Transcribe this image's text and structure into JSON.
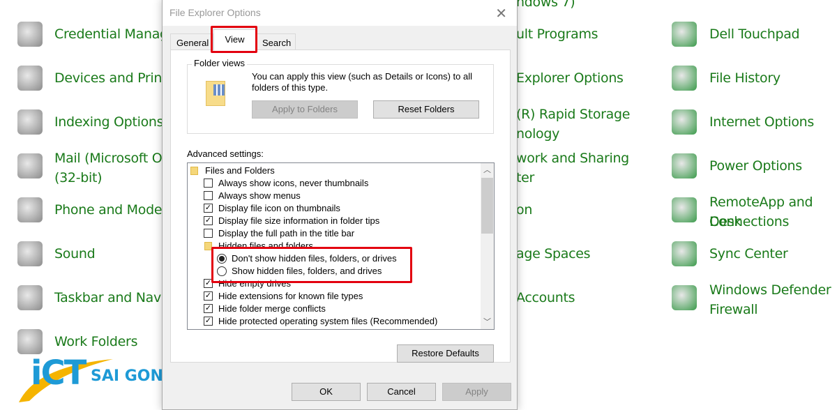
{
  "control_panel": {
    "left": [
      {
        "label": "Credential Manag",
        "icon": "credential-manager-icon"
      },
      {
        "label": "Devices and Printe",
        "icon": "devices-printers-icon"
      },
      {
        "label": "Indexing Options",
        "icon": "indexing-options-icon"
      },
      {
        "label": "Mail (Microsoft O",
        "label2": "(32-bit)",
        "icon": "mail-icon"
      },
      {
        "label": "Phone and Moder",
        "icon": "phone-modem-icon"
      },
      {
        "label": "Sound",
        "icon": "sound-icon"
      },
      {
        "label": "Taskbar and Navig",
        "icon": "taskbar-icon"
      },
      {
        "label": "Work Folders",
        "icon": "work-folders-icon"
      }
    ],
    "middle": [
      {
        "label": "ndows 7)"
      },
      {
        "label": "ult Programs"
      },
      {
        "label": "Explorer Options"
      },
      {
        "label": "(R) Rapid Storage",
        "label2": "nology"
      },
      {
        "label": "work and Sharing",
        "label2": "ter"
      },
      {
        "label": "on"
      },
      {
        "label": "age Spaces"
      },
      {
        "label": "Accounts"
      }
    ],
    "right": [
      {
        "label": "Dell Touchpad",
        "icon": "touchpad-icon"
      },
      {
        "label": "File History",
        "icon": "file-history-icon"
      },
      {
        "label": "Internet Options",
        "icon": "internet-options-icon"
      },
      {
        "label": "Power Options",
        "icon": "power-options-icon"
      },
      {
        "label": "RemoteApp and Desk",
        "label2": "Connections",
        "icon": "remoteapp-icon"
      },
      {
        "label": "Sync Center",
        "icon": "sync-center-icon"
      },
      {
        "label": "Windows Defender",
        "label2": "Firewall",
        "icon": "firewall-icon"
      }
    ],
    "text_color": "#1a7a1a"
  },
  "watermark": {
    "text1": "iCT",
    "text2": "SAI GON"
  },
  "dialog": {
    "title": "File Explorer Options",
    "tabs": [
      {
        "label": "General"
      },
      {
        "label": "View",
        "selected": true
      },
      {
        "label": "Search"
      }
    ],
    "folder_views": {
      "label": "Folder views",
      "description_line1": "You can apply this view (such as Details or Icons) to all",
      "description_line2": "folders of this type.",
      "apply_button": "Apply to Folders",
      "reset_button": "Reset Folders"
    },
    "advanced_label": "Advanced settings:",
    "settings": [
      {
        "type": "folder",
        "label": "Files and Folders"
      },
      {
        "type": "checkbox",
        "label": "Always show icons, never thumbnails",
        "checked": false
      },
      {
        "type": "checkbox",
        "label": "Always show menus",
        "checked": false
      },
      {
        "type": "checkbox",
        "label": "Display file icon on thumbnails",
        "checked": true
      },
      {
        "type": "checkbox",
        "label": "Display file size information in folder tips",
        "checked": true
      },
      {
        "type": "checkbox",
        "label": "Display the full path in the title bar",
        "checked": false
      },
      {
        "type": "subfolder",
        "label": "Hidden files and folders"
      },
      {
        "type": "radio",
        "label": "Don't show hidden files, folders, or drives",
        "checked": true
      },
      {
        "type": "radio",
        "label": "Show hidden files, folders, and drives",
        "checked": false
      },
      {
        "type": "checkbox",
        "label": "Hide empty drives",
        "checked": true
      },
      {
        "type": "checkbox",
        "label": "Hide extensions for known file types",
        "checked": true
      },
      {
        "type": "checkbox",
        "label": "Hide folder merge conflicts",
        "checked": true
      },
      {
        "type": "checkbox",
        "label": "Hide protected operating system files (Recommended)",
        "checked": true
      }
    ],
    "restore_defaults": "Restore Defaults",
    "ok": "OK",
    "cancel": "Cancel",
    "apply": "Apply",
    "highlight_color": "#e3000f"
  }
}
